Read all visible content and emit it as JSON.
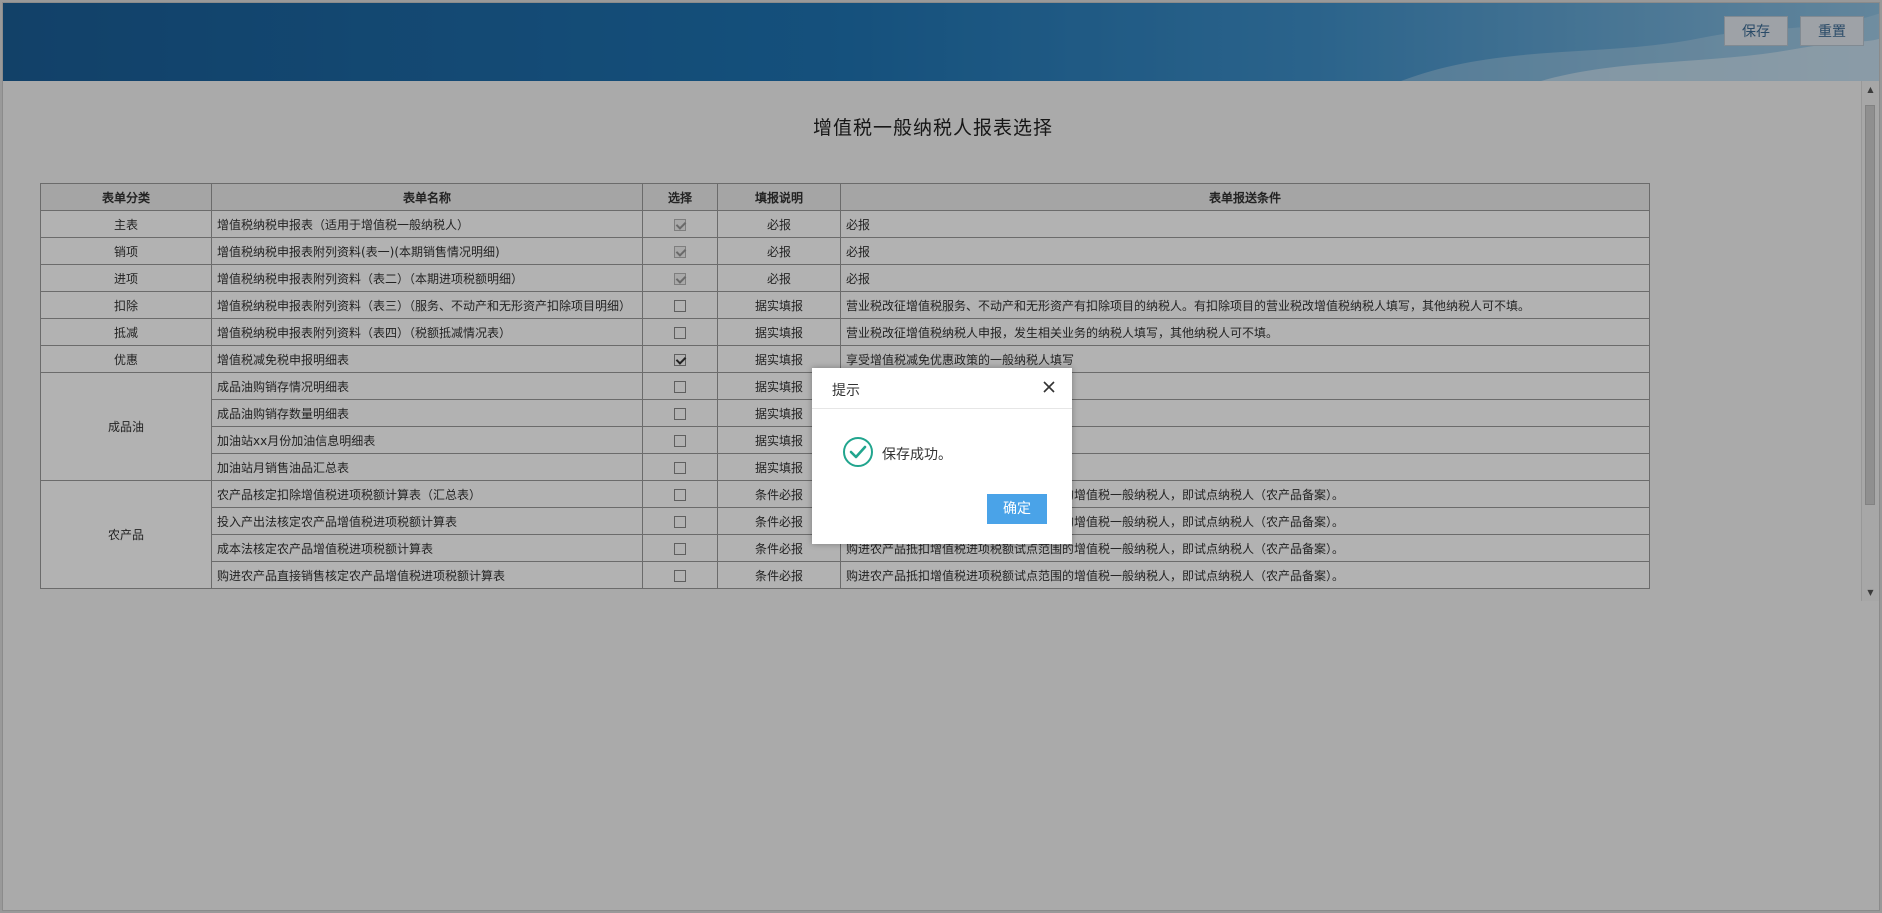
{
  "header": {
    "save_label": "保存",
    "reset_label": "重置"
  },
  "page_title": "增值税一般纳税人报表选择",
  "table": {
    "headers": [
      "表单分类",
      "表单名称",
      "选择",
      "填报说明",
      "表单报送条件"
    ],
    "rows": [
      {
        "category": "主表",
        "name": "增值税纳税申报表（适用于增值税一般纳税人）",
        "checked": true,
        "disabled": true,
        "note": "必报",
        "condition": "必报"
      },
      {
        "category": "销项",
        "name": "增值税纳税申报表附列资料(表一)(本期销售情况明细)",
        "checked": true,
        "disabled": true,
        "note": "必报",
        "condition": "必报"
      },
      {
        "category": "进项",
        "name": "增值税纳税申报表附列资料（表二）（本期进项税额明细）",
        "checked": true,
        "disabled": true,
        "note": "必报",
        "condition": "必报"
      },
      {
        "category": "扣除",
        "name": "增值税纳税申报表附列资料（表三）（服务、不动产和无形资产扣除项目明细）",
        "checked": false,
        "disabled": false,
        "note": "据实填报",
        "condition": "营业税改征增值税服务、不动产和无形资产有扣除项目的纳税人。有扣除项目的营业税改增值税纳税人填写，其他纳税人可不填。"
      },
      {
        "category": "抵减",
        "name": "增值税纳税申报表附列资料（表四）（税额抵减情况表）",
        "checked": false,
        "disabled": false,
        "note": "据实填报",
        "condition": "营业税改征增值税纳税人申报，发生相关业务的纳税人填写，其他纳税人可不填。"
      },
      {
        "category": "优惠",
        "name": "增值税减免税申报明细表",
        "checked": true,
        "disabled": false,
        "note": "据实填报",
        "condition": "享受增值税减免优惠政策的一般纳税人填写"
      },
      {
        "category": "成品油",
        "rowspan": 4,
        "name": "成品油购销存情况明细表",
        "checked": false,
        "disabled": false,
        "note": "据实填报",
        "condition": ""
      },
      {
        "name": "成品油购销存数量明细表",
        "checked": false,
        "disabled": false,
        "note": "据实填报",
        "condition": ""
      },
      {
        "name": "加油站xx月份加油信息明细表",
        "checked": false,
        "disabled": false,
        "note": "据实填报",
        "condition": ""
      },
      {
        "name": "加油站月销售油品汇总表",
        "checked": false,
        "disabled": false,
        "note": "据实填报",
        "condition": ""
      },
      {
        "category": "农产品",
        "rowspan": 4,
        "name": "农产品核定扣除增值税进项税额计算表（汇总表）",
        "checked": false,
        "disabled": false,
        "note": "条件必报",
        "condition": "购进农产品抵扣增值税进项税额试点范围的增值税一般纳税人，即试点纳税人（农产品备案）。"
      },
      {
        "name": "投入产出法核定农产品增值税进项税额计算表",
        "checked": false,
        "disabled": false,
        "note": "条件必报",
        "condition": "购进农产品抵扣增值税进项税额试点范围的增值税一般纳税人，即试点纳税人（农产品备案）。"
      },
      {
        "name": "成本法核定农产品增值税进项税额计算表",
        "checked": false,
        "disabled": false,
        "note": "条件必报",
        "condition": "购进农产品抵扣增值税进项税额试点范围的增值税一般纳税人，即试点纳税人（农产品备案）。"
      },
      {
        "name": "购进农产品直接销售核定农产品增值税进项税额计算表",
        "checked": false,
        "disabled": false,
        "note": "条件必报",
        "condition": "购进农产品抵扣增值税进项税额试点范围的增值税一般纳税人，即试点纳税人（农产品备案）。"
      }
    ]
  },
  "dialog": {
    "title": "提示",
    "message": "保存成功。",
    "ok_label": "确定"
  },
  "colors": {
    "header_blue": "#1f74b3",
    "ok_button": "#4aa3e8",
    "success_icon": "#21a58e"
  }
}
